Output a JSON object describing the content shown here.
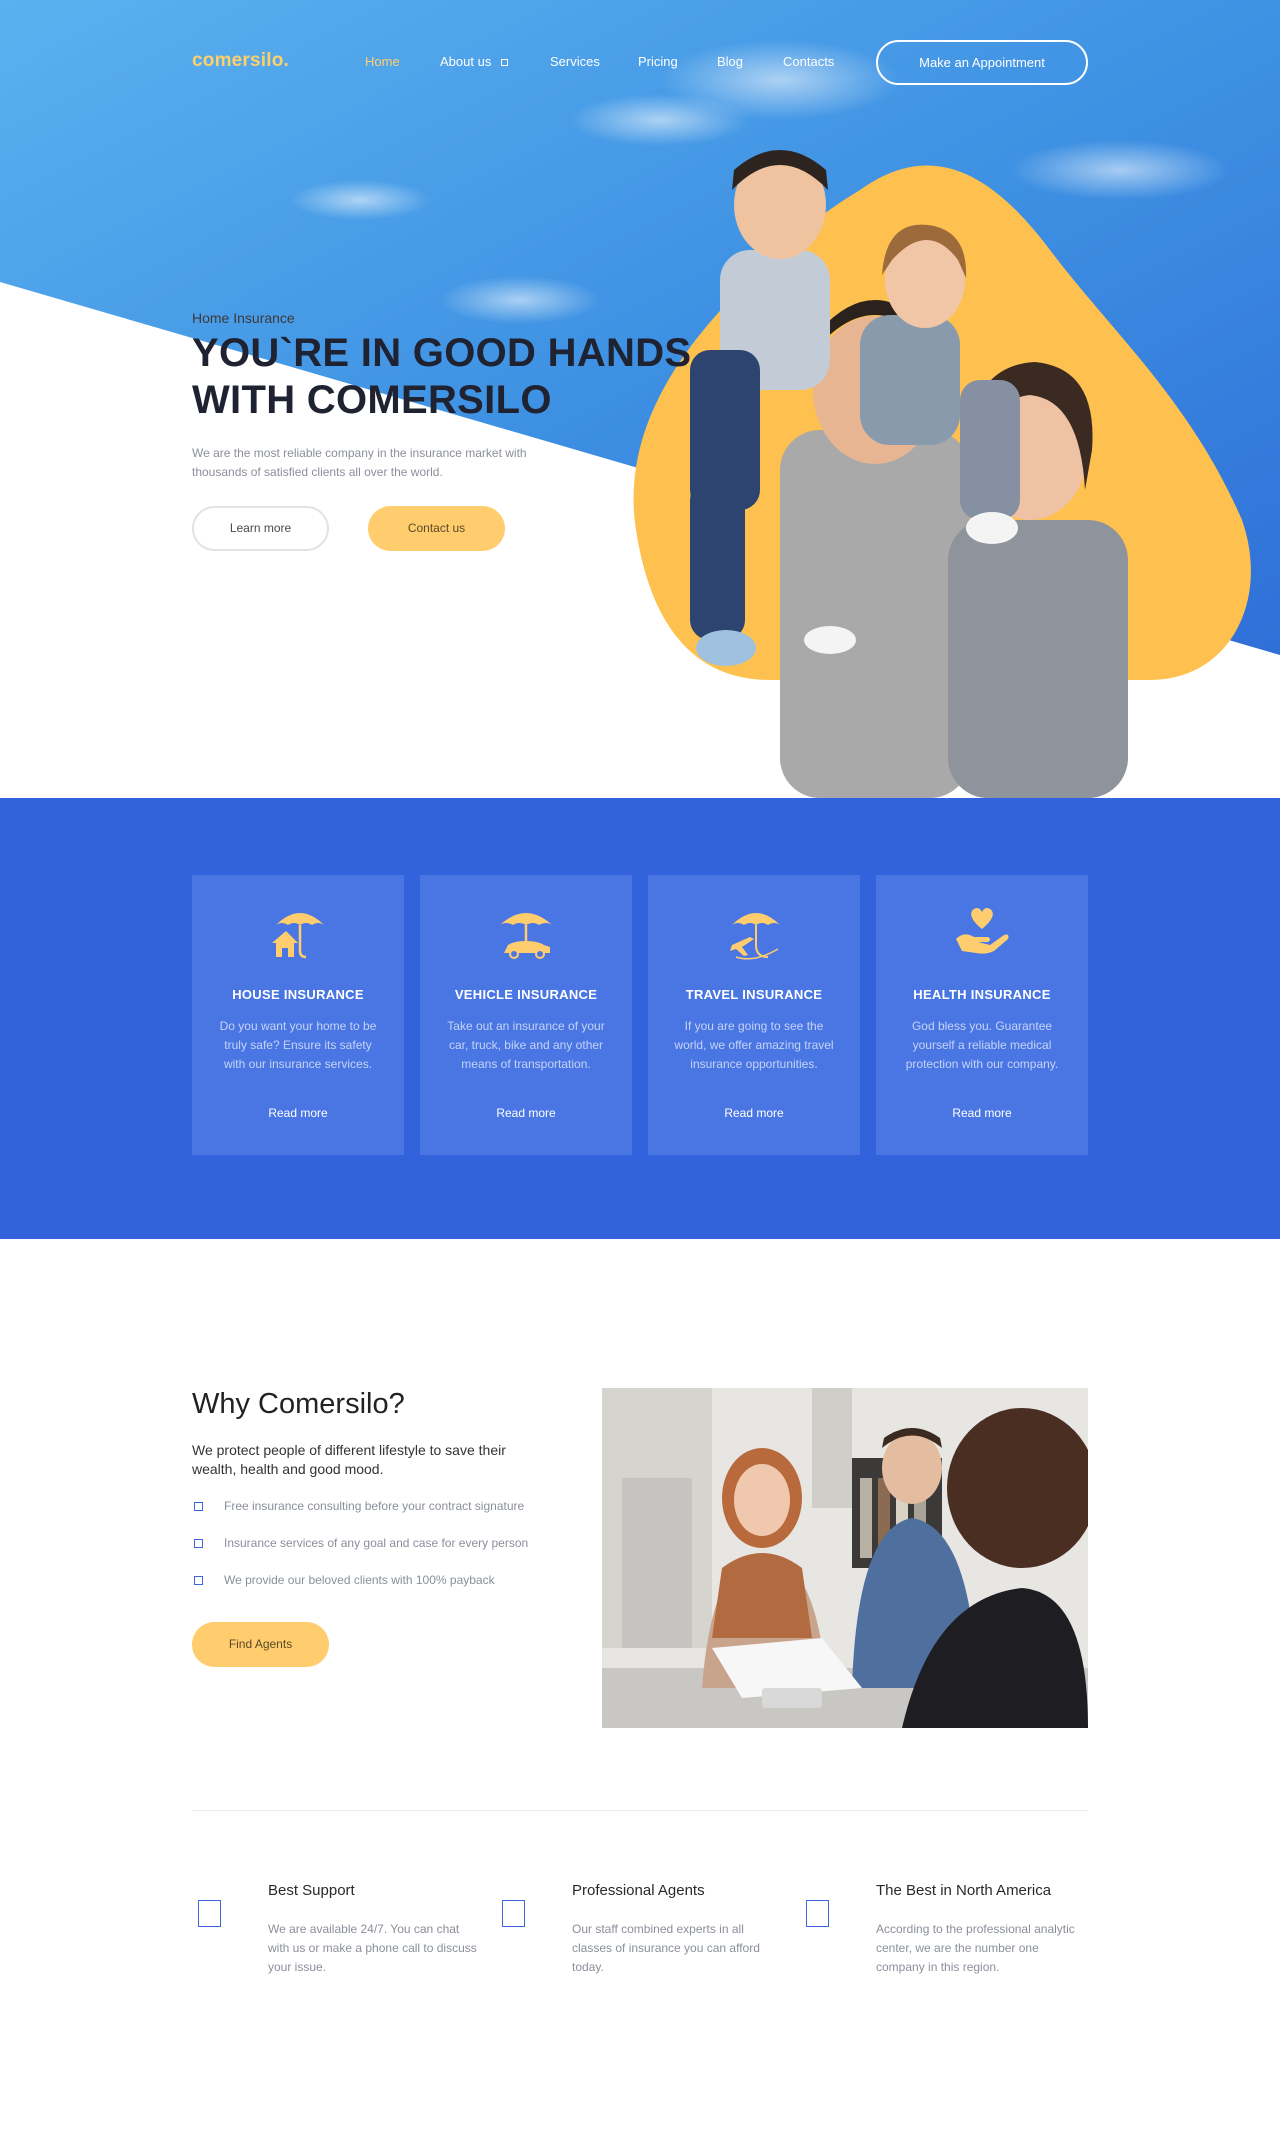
{
  "brand": {
    "logo": "comersilo."
  },
  "nav": {
    "items": [
      "Home",
      "About us",
      "Services",
      "Pricing",
      "Blog",
      "Contacts"
    ],
    "active": "Home",
    "cta": "Make an Appointment"
  },
  "hero": {
    "eyebrow": "Home Insurance",
    "title_line1": "YOU`RE IN GOOD HANDS",
    "title_line2": "WITH COMERSILO",
    "description": "We are the most reliable company in the insurance market with thousands of satisfied clients all over the world.",
    "btn_learn": "Learn more",
    "btn_contact": "Contact us"
  },
  "services": [
    {
      "title": "HOUSE INSURANCE",
      "text": "Do you want your home to be truly safe? Ensure its safety with our insurance services.",
      "more": "Read more",
      "icon": "house-umbrella-icon"
    },
    {
      "title": "VEHICLE INSURANCE",
      "text": "Take out an insurance of your car, truck, bike and any other means of transportation.",
      "more": "Read more",
      "icon": "car-umbrella-icon"
    },
    {
      "title": "TRAVEL INSURANCE",
      "text": "If you are going to see the world, we offer amazing travel insurance opportunities.",
      "more": "Read more",
      "icon": "plane-umbrella-icon"
    },
    {
      "title": "HEALTH INSURANCE",
      "text": "God bless you. Guarantee yourself a reliable medical protection with our company.",
      "more": "Read more",
      "icon": "heart-hand-icon"
    }
  ],
  "why": {
    "title": "Why Comersilo?",
    "lead": "We protect people of different lifestyle to save their wealth, health and good mood.",
    "items": [
      "Free insurance consulting before your contract signature",
      "Insurance services of any goal and case for every person",
      "We provide our beloved clients with 100% payback"
    ],
    "btn": "Find Agents"
  },
  "features": [
    {
      "title": "Best Support",
      "text": "We are available 24/7. You can chat with us or make a phone call to discuss your issue."
    },
    {
      "title": "Professional Agents",
      "text": "Our staff combined experts in all classes of insurance you can afford today."
    },
    {
      "title": "The Best in North America",
      "text": "According to the professional analytic center, we are the number one company in this region."
    }
  ],
  "colors": {
    "accent_blue": "#3362dd",
    "accent_yellow": "#ffcd6d",
    "sky": "#3d93e4",
    "text_dark": "#1f2230"
  }
}
